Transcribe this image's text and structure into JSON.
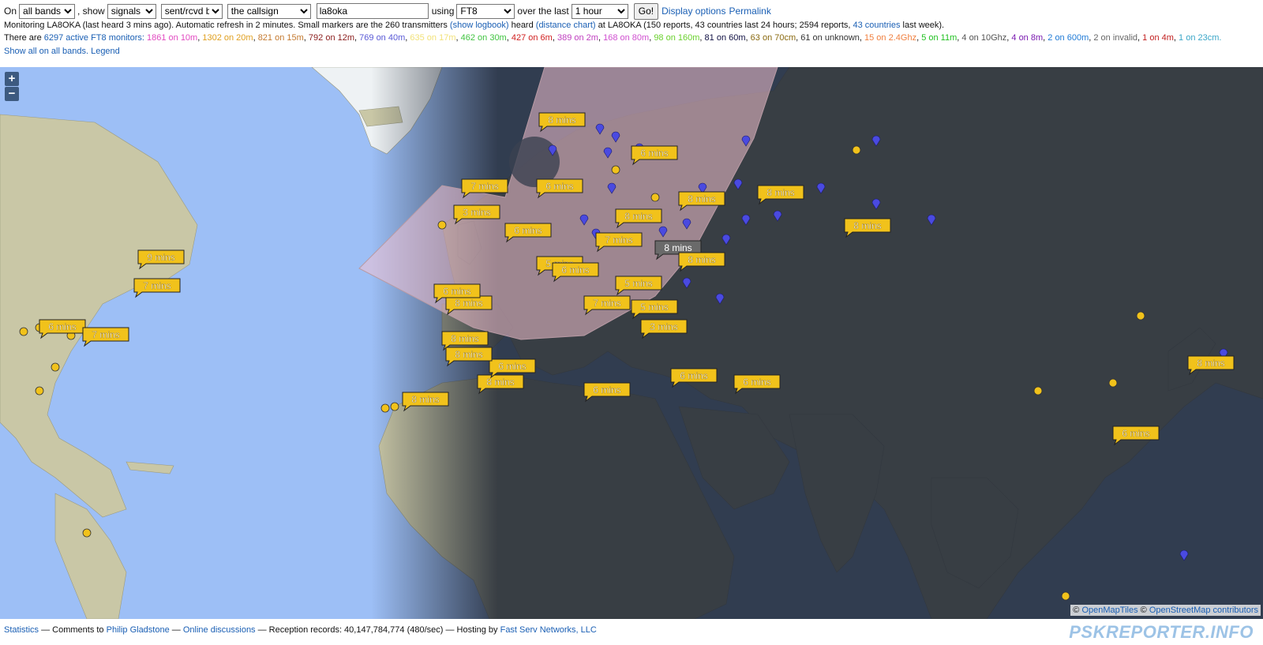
{
  "controls": {
    "on_label": "On",
    "band_value": "all bands",
    "show_label": ", show",
    "show_value": "signals",
    "direction_value": "sent/rcvd by",
    "target_value": "the callsign",
    "callsign_value": "la8oka",
    "using_label": "using",
    "mode_value": "FT8",
    "over_label": "over the last",
    "period_value": "1 hour",
    "go_label": "Go!",
    "display_options": "Display options",
    "permalink": "Permalink"
  },
  "status": {
    "monitoring_text": "Monitoring LA8OKA (last heard 3 mins ago). Automatic refresh in 2 minutes. Small markers are the 260 transmitters",
    "show_logbook": "(show logbook)",
    "heard": "heard",
    "distance_chart": "(distance chart)",
    "at_text": "at LA8OKA (150 reports, 43 countries last 24 hours; 2594 reports,",
    "countries_link": "43 countries",
    "last_week": "last week)."
  },
  "monitors": {
    "prefix": "There are",
    "count_link": "6297 active FT8 monitors:",
    "bands": [
      {
        "text": "1861 on 10m",
        "color": "#e24ac1"
      },
      {
        "text": "1302 on 20m",
        "color": "#e0a020"
      },
      {
        "text": "821 on 15m",
        "color": "#c47a30"
      },
      {
        "text": "792 on 12m",
        "color": "#8a1c1c"
      },
      {
        "text": "769 on 40m",
        "color": "#5a5ad6"
      },
      {
        "text": "635 on 17m",
        "color": "#f2e27a"
      },
      {
        "text": "462 on 30m",
        "color": "#41c441"
      },
      {
        "text": "427 on 6m",
        "color": "#d01f1f"
      },
      {
        "text": "389 on 2m",
        "color": "#c040c0"
      },
      {
        "text": "168 on 80m",
        "color": "#d050d0"
      },
      {
        "text": "98 on 160m",
        "color": "#6bd12e"
      },
      {
        "text": "81 on 60m",
        "color": "#111144"
      },
      {
        "text": "63 on 70cm",
        "color": "#8a6a10"
      },
      {
        "text": "61 on unknown",
        "color": "#333333"
      },
      {
        "text": "15 on 2.4Ghz",
        "color": "#f08040"
      },
      {
        "text": "5 on 11m",
        "color": "#20c020"
      },
      {
        "text": "4 on 10Ghz",
        "color": "#555555"
      },
      {
        "text": "4 on 8m",
        "color": "#7a1ab0"
      },
      {
        "text": "2 on 600m",
        "color": "#1f7ad6"
      },
      {
        "text": "2 on invalid",
        "color": "#666666"
      },
      {
        "text": "1 on 4m",
        "color": "#c21f1f"
      },
      {
        "text": "1 on 23cm.",
        "color": "#3aa6c8"
      }
    ]
  },
  "links": {
    "show_all": "Show all on all bands.",
    "legend": "Legend"
  },
  "map": {
    "zoom_in": "+",
    "zoom_out": "−",
    "labels": [
      {
        "text": "8 mins",
        "dim": false
      },
      {
        "text": "6 mins",
        "dim": false
      },
      {
        "text": "9 mins",
        "dim": false
      },
      {
        "text": "7 mins",
        "dim": false
      },
      {
        "text": "8 mins",
        "dim": false
      },
      {
        "text": "6 mins",
        "dim": false
      },
      {
        "text": "8 mins",
        "dim": true
      },
      {
        "text": "7 mins",
        "dim": false
      },
      {
        "text": "3 mins",
        "dim": false
      },
      {
        "text": "6 mins",
        "dim": false
      },
      {
        "text": "5 mins",
        "dim": false
      },
      {
        "text": "8 mins",
        "dim": false
      },
      {
        "text": "7 mins",
        "dim": false
      },
      {
        "text": "5 mins",
        "dim": false
      },
      {
        "text": "6 mins",
        "dim": false
      },
      {
        "text": "8 mins",
        "dim": false
      },
      {
        "text": "8 mins",
        "dim": false
      },
      {
        "text": "6 mins",
        "dim": false
      },
      {
        "text": "3 mins",
        "dim": false
      },
      {
        "text": "6 mins",
        "dim": false
      },
      {
        "text": "8 mins",
        "dim": false
      },
      {
        "text": "8 mins",
        "dim": false
      },
      {
        "text": "6 mins",
        "dim": false
      },
      {
        "text": "8 mins",
        "dim": false
      },
      {
        "text": "6 mins",
        "dim": false
      },
      {
        "text": "7 mins",
        "dim": false
      },
      {
        "text": "6 mins",
        "dim": false
      },
      {
        "text": "5 mins",
        "dim": false
      },
      {
        "text": "6 mins",
        "dim": false
      },
      {
        "text": "8 mins",
        "dim": false
      },
      {
        "text": "8 mins",
        "dim": false
      },
      {
        "text": "8 mins",
        "dim": false
      },
      {
        "text": "6 mins",
        "dim": false
      },
      {
        "text": "7 mins",
        "dim": false
      },
      {
        "text": "8 mins",
        "dim": false
      }
    ],
    "attribution": {
      "prefix": "©",
      "tiles": "OpenMapTiles",
      "mid": "©",
      "osm": "OpenStreetMap contributors"
    }
  },
  "footer": {
    "statistics": "Statistics",
    "comments": "— Comments to",
    "author": "Philip Gladstone",
    "dash1": "—",
    "discussions": "Online discussions",
    "reception": "— Reception records: 40,147,784,774 (480/sec) — Hosting by",
    "hosting": "Fast Serv Networks, LLC",
    "brand": "PSKREPORTER.INFO"
  }
}
